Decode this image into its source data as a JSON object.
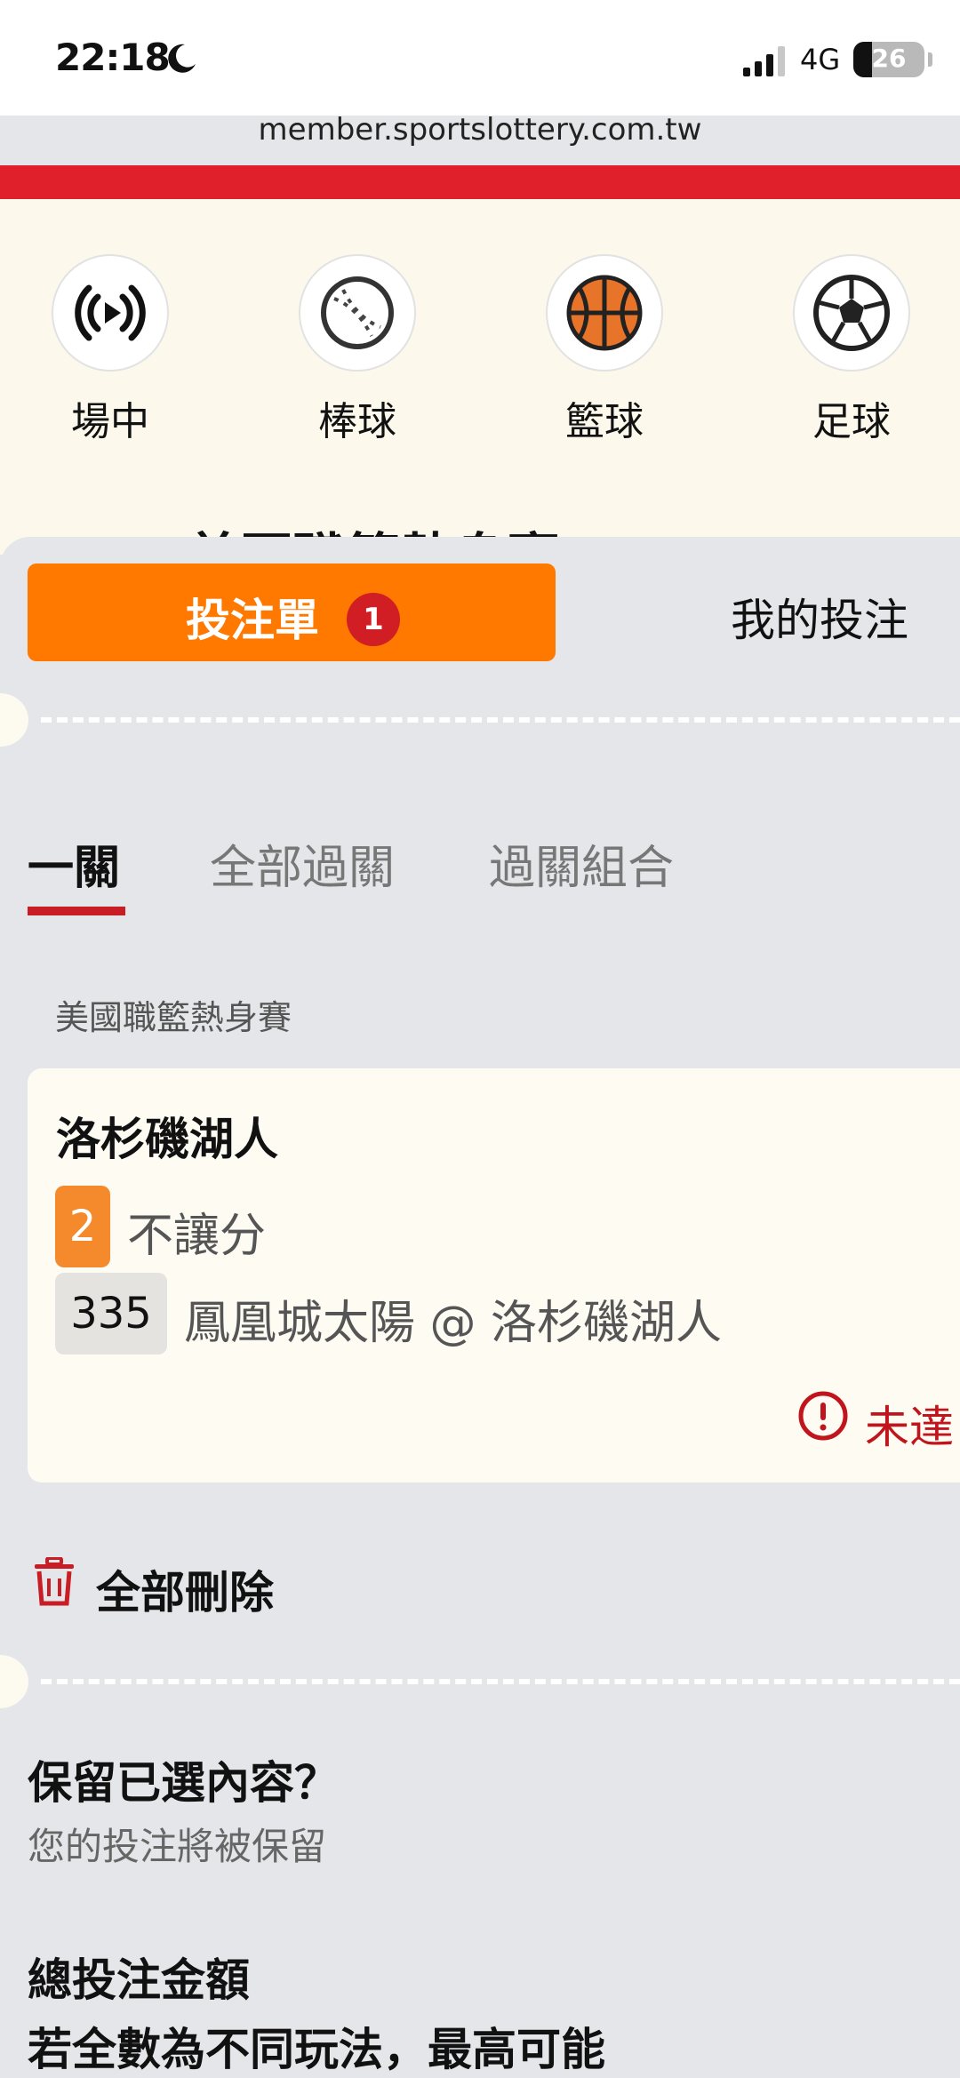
{
  "status_bar": {
    "time": "22:18",
    "network": "4G",
    "battery": "26"
  },
  "browser": {
    "url": "member.sportslottery.com.tw"
  },
  "sports_nav": [
    {
      "label": "場中",
      "icon": "live-broadcast-icon"
    },
    {
      "label": "棒球",
      "icon": "baseball-icon"
    },
    {
      "label": "籃球",
      "icon": "basketball-icon"
    },
    {
      "label": "足球",
      "icon": "soccer-ball-icon"
    }
  ],
  "page_heading_peek": "美國職籃熱身賽",
  "betslip": {
    "tab_active": "投注單",
    "tab_badge": "1",
    "tab_other": "我的投注",
    "subtabs": [
      "一關",
      "全部過關",
      "過關組合"
    ],
    "league": "美國職籃熱身賽",
    "selection": {
      "team": "洛杉磯湖人",
      "pick_number": "2",
      "pick_type": "不讓分",
      "match_code": "335",
      "match": "鳳凰城太陽 @ 洛杉磯湖人",
      "warning_text": "未達"
    },
    "delete_all": "全部刪除",
    "keep_question": "保留已選內容？",
    "keep_note": "您的投注將被保留",
    "total_label": "總投注金額",
    "max_note": "若全數為不同玩法，最高可能"
  },
  "colors": {
    "accent": "#ff7800",
    "brand_red": "#e0212b",
    "warning_red": "#c1151d",
    "pick_orange": "#f48a2b"
  }
}
